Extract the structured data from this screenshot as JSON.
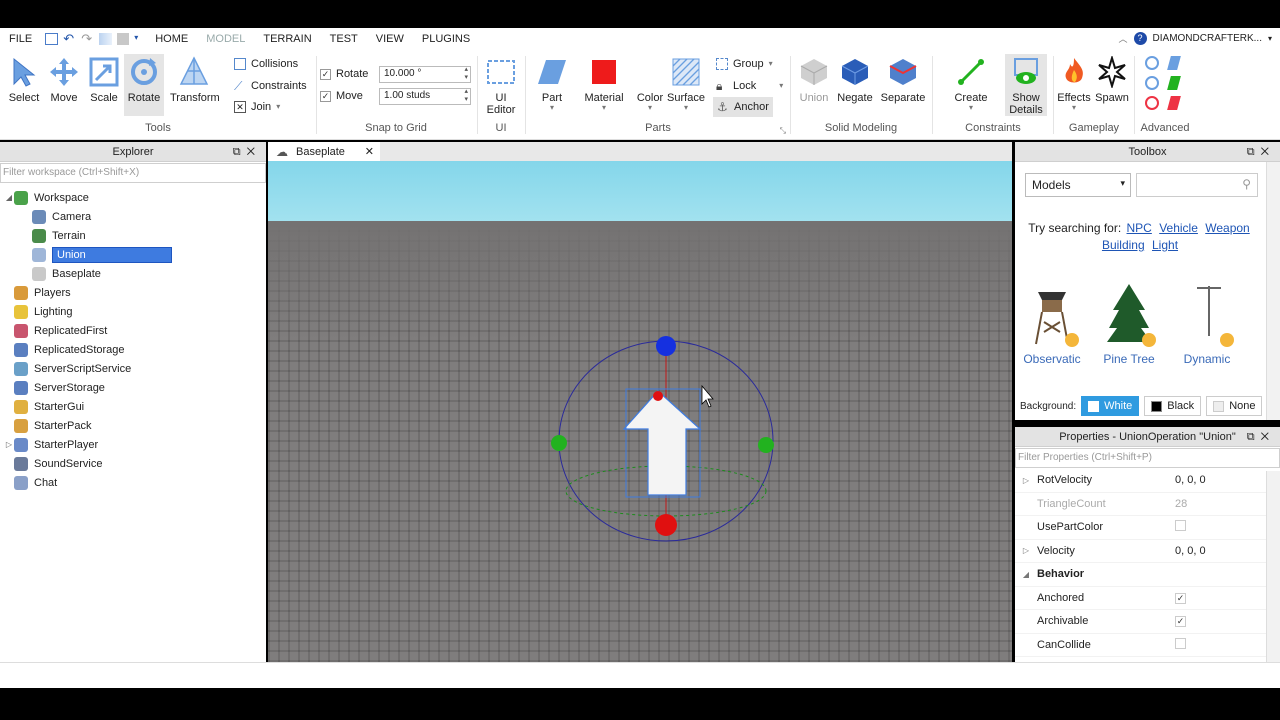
{
  "menu": {
    "items": [
      "FILE",
      "HOME",
      "MODEL",
      "TERRAIN",
      "TEST",
      "VIEW",
      "PLUGINS"
    ],
    "active": "MODEL",
    "username": "DIAMONDCRAFTERK..."
  },
  "ribbon": {
    "tools": {
      "title": "Tools",
      "select": "Select",
      "move": "Move",
      "scale": "Scale",
      "rotate": "Rotate",
      "transform": "Transform"
    },
    "snap": {
      "title": "Snap to Grid",
      "collisions": "Collisions",
      "constraints": "Constraints",
      "join": "Join",
      "rotate_label": "Rotate",
      "rotate_value": "10.000 °",
      "move_label": "Move",
      "move_value": "1.00 studs"
    },
    "ui": {
      "title": "UI",
      "editor_line1": "UI",
      "editor_line2": "Editor"
    },
    "parts": {
      "title": "Parts",
      "part": "Part",
      "material": "Material",
      "color": "Color",
      "surface": "Surface",
      "group": "Group",
      "lock": "Lock",
      "anchor": "Anchor"
    },
    "solid": {
      "title": "Solid Modeling",
      "union": "Union",
      "negate": "Negate",
      "separate": "Separate"
    },
    "constraints": {
      "title": "Constraints",
      "create": "Create",
      "show_line1": "Show",
      "show_line2": "Details"
    },
    "gameplay": {
      "title": "Gameplay",
      "effects": "Effects",
      "spawn": "Spawn"
    },
    "advanced": {
      "title": "Advanced"
    }
  },
  "explorer": {
    "title": "Explorer",
    "filter_placeholder": "Filter workspace (Ctrl+Shift+X)",
    "workspace": "Workspace",
    "children": [
      "Camera",
      "Terrain",
      "Union",
      "Baseplate"
    ],
    "services": [
      "Players",
      "Lighting",
      "ReplicatedFirst",
      "ReplicatedStorage",
      "ServerScriptService",
      "ServerStorage",
      "StarterGui",
      "StarterPack",
      "StarterPlayer",
      "SoundService",
      "Chat"
    ],
    "selected": "Union"
  },
  "viewport": {
    "tab": "Baseplate"
  },
  "toolbox": {
    "title": "Toolbox",
    "category": "Models",
    "try_label": "Try searching for:",
    "suggestions": [
      "NPC",
      "Vehicle",
      "Weapon",
      "Building",
      "Light"
    ],
    "assets": [
      "Observatic",
      "Pine Tree",
      "Dynamic"
    ],
    "background_label": "Background:",
    "bg_options": [
      "White",
      "Black",
      "None"
    ],
    "bg_selected": "White"
  },
  "properties": {
    "title": "Properties - UnionOperation \"Union\"",
    "filter_placeholder": "Filter Properties (Ctrl+Shift+P)",
    "rows": [
      {
        "name": "RotVelocity",
        "value": "0, 0, 0"
      },
      {
        "name": "TriangleCount",
        "value": "28"
      },
      {
        "name": "UsePartColor",
        "value": ""
      },
      {
        "name": "Velocity",
        "value": "0, 0, 0"
      },
      {
        "name": "Behavior",
        "value": ""
      },
      {
        "name": "Anchored",
        "value": "✓"
      },
      {
        "name": "Archivable",
        "value": "✓"
      },
      {
        "name": "CanCollide",
        "value": ""
      }
    ]
  },
  "colors": {
    "accent": "#3e7be0",
    "select_blue": "#2f9be0",
    "handle_red": "#e01010",
    "handle_green": "#22b21f",
    "handle_blue": "#1530e0"
  }
}
